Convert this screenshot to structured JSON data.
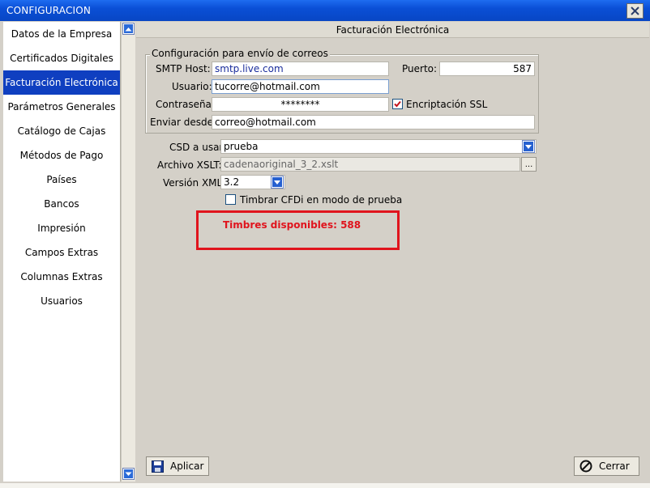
{
  "window": {
    "title": "CONFIGURACION"
  },
  "sidebar": {
    "items": [
      {
        "label": "Datos de la Empresa",
        "active": false
      },
      {
        "label": "Certificados Digitales",
        "active": false
      },
      {
        "label": "Facturación Electrónica",
        "active": true
      },
      {
        "label": "Parámetros Generales",
        "active": false
      },
      {
        "label": "Catálogo de Cajas",
        "active": false
      },
      {
        "label": "Métodos de Pago",
        "active": false
      },
      {
        "label": "Países",
        "active": false
      },
      {
        "label": "Bancos",
        "active": false
      },
      {
        "label": "Impresión",
        "active": false
      },
      {
        "label": "Campos Extras",
        "active": false
      },
      {
        "label": "Columnas Extras",
        "active": false
      },
      {
        "label": "Usuarios",
        "active": false
      }
    ]
  },
  "panel": {
    "title": "Facturación Electrónica",
    "email_group": {
      "legend": "Configuración para envío de correos",
      "smtp_host_label": "SMTP Host:",
      "smtp_host_value": "smtp.live.com",
      "puerto_label": "Puerto:",
      "puerto_value": "587",
      "usuario_label": "Usuario:",
      "usuario_value": "tucorre@hotmail.com",
      "contrasena_label": "Contraseña:",
      "contrasena_value": "********",
      "ssl_label": "Encriptación SSL",
      "ssl_checked": true,
      "enviar_desde_label": "Enviar desde:",
      "enviar_desde_value": "correo@hotmail.com"
    },
    "csd_label": "CSD a usar:",
    "csd_value": "prueba",
    "xslt_label": "Archivo XSLT:",
    "xslt_value": "cadenaoriginal_3_2.xslt",
    "xslt_button": "...",
    "version_label": "Versión XML:",
    "version_value": "3.2",
    "timbrar_label": "Timbrar CFDi en modo de prueba",
    "timbrar_checked": false,
    "timbres_text": "Timbres disponibles: 588"
  },
  "buttons": {
    "aplicar": "Aplicar",
    "cerrar": "Cerrar"
  },
  "colors": {
    "titlebar": "#0a4fd6",
    "active_item": "#0f3fc0",
    "highlight_red": "#e0141d",
    "window_bg": "#d4d0c8"
  }
}
